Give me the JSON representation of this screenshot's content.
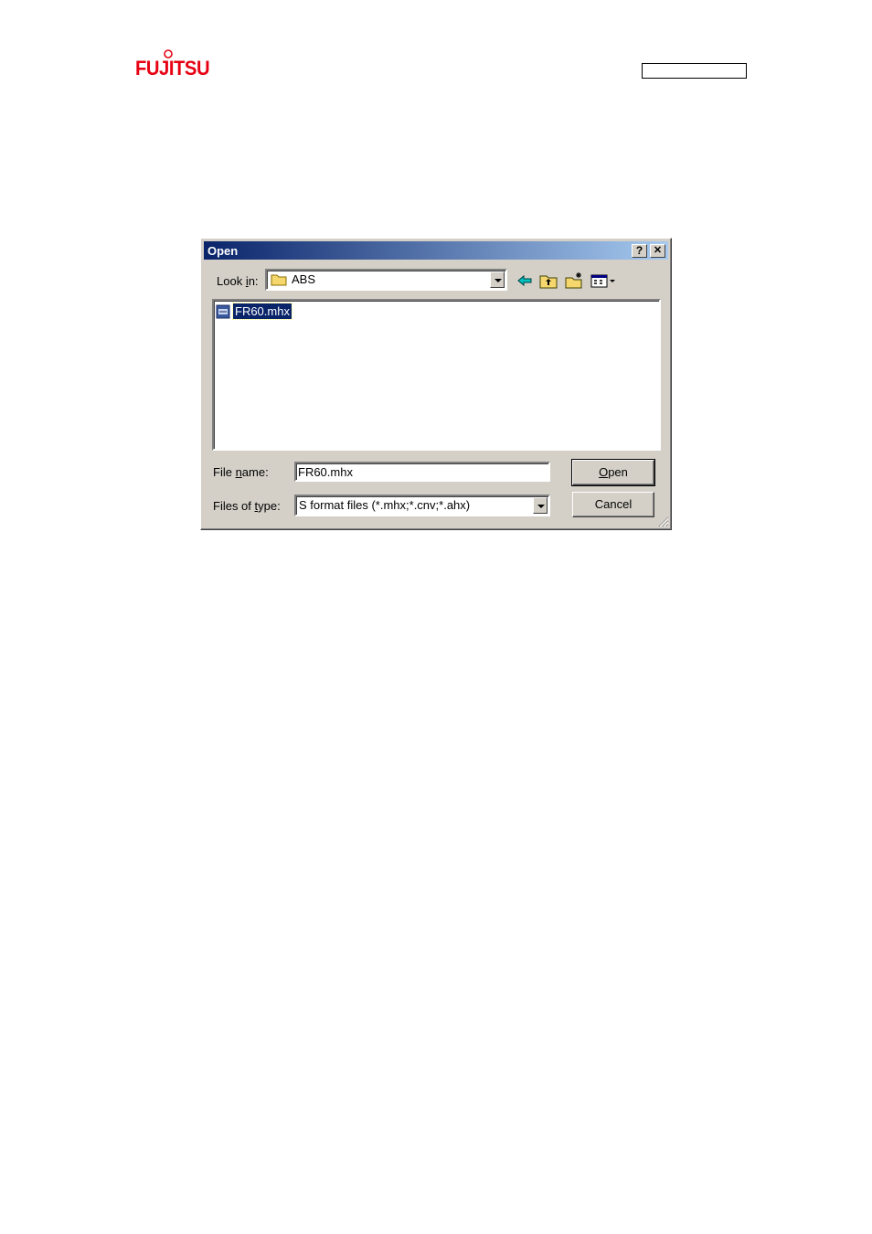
{
  "header": {
    "logo_text": "FUJITSU"
  },
  "dialog": {
    "title": "Open",
    "help_button": "?",
    "close_button": "✕",
    "look_in": {
      "label_pre": "Look ",
      "label_hotkey": "i",
      "label_post": "n:",
      "value": "ABS"
    },
    "toolbar": {
      "icons": [
        "back-icon",
        "up-folder-icon",
        "new-folder-icon",
        "view-menu-icon"
      ]
    },
    "files": [
      {
        "name": "FR60.mhx",
        "icon": "s-format-file-icon",
        "selected": true
      }
    ],
    "file_name": {
      "label_pre": "File ",
      "label_hotkey": "n",
      "label_post": "ame:",
      "value": "FR60.mhx"
    },
    "files_of_type": {
      "label_pre": "Files of ",
      "label_hotkey": "t",
      "label_post": "ype:",
      "value": "S format files (*.mhx;*.cnv;*.ahx)"
    },
    "open_button": {
      "hotkey": "O",
      "rest": "pen"
    },
    "cancel_button": "Cancel"
  },
  "colors": {
    "logo": "#e60012",
    "titlebar_start": "#0a246a",
    "titlebar_end": "#a6caf0",
    "dialog_face": "#d4d0c8",
    "selection": "#0a246a"
  }
}
